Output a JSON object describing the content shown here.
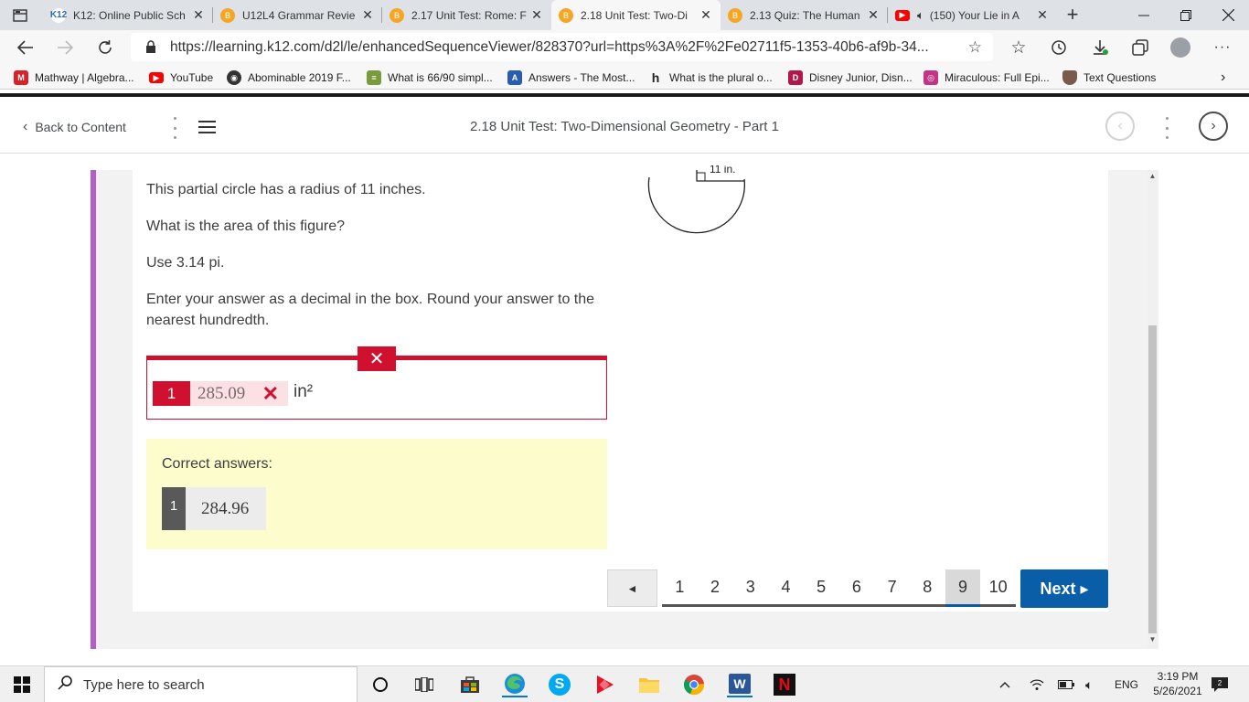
{
  "browser": {
    "tabs": [
      {
        "title": "K12: Online Public Sch",
        "favicon": "k12-icon",
        "active": false
      },
      {
        "title": "U12L4 Grammar Revie",
        "favicon": "brainly-icon",
        "active": false
      },
      {
        "title": "2.17 Unit Test: Rome: F",
        "favicon": "brainly-icon",
        "active": false
      },
      {
        "title": "2.18 Unit Test: Two-Di",
        "favicon": "brainly-icon",
        "active": true
      },
      {
        "title": "2.13 Quiz: The Human",
        "favicon": "brainly-icon",
        "active": false
      },
      {
        "title": "(150) Your Lie in A",
        "favicon": "youtube-icon",
        "active": false
      }
    ],
    "url": "https://learning.k12.com/d2l/le/enhancedSequenceViewer/828370?url=https%3A%2F%2Fe02711f5-1353-40b6-af9b-34...",
    "bookmarks": [
      {
        "label": "Mathway | Algebra...",
        "icon": "mathway-icon",
        "color": "#d8232a"
      },
      {
        "label": "YouTube",
        "icon": "youtube-icon",
        "color": "#ff0000"
      },
      {
        "label": "Abominable 2019 F...",
        "icon": "film-reel-icon",
        "color": "#333333"
      },
      {
        "label": "What is 66/90 simpl...",
        "icon": "calculator-icon",
        "color": "#7a9b3c"
      },
      {
        "label": "Answers - The Most...",
        "icon": "answers-icon",
        "color": "#2a5db0"
      },
      {
        "label": "What is the plural o...",
        "icon": "h-icon",
        "color": "#222222"
      },
      {
        "label": "Disney Junior, Disn...",
        "icon": "disney-icon",
        "color": "#b0184a"
      },
      {
        "label": "Miraculous: Full Epi...",
        "icon": "instagram-icon",
        "color": "#c13584"
      },
      {
        "label": "Text Questions",
        "icon": "shield-icon",
        "color": "#7a5a4a"
      }
    ]
  },
  "app": {
    "back_label": "Back to Content",
    "page_title": "2.18 Unit Test: Two-Dimensional Geometry - Part 1"
  },
  "question": {
    "line1": "This partial circle has a radius of 11 inches.",
    "line2": "What is the area of this figure?",
    "line3": "Use 3.14 pi.",
    "line4": "Enter your answer as a decimal in the box. Round your answer to the nearest hundredth.",
    "figure_label": "11 in.",
    "answer_index": "1",
    "answer_value": "285.09",
    "answer_unit": "in²",
    "answer_status": "incorrect",
    "correct_label": "Correct answers:",
    "correct_index": "1",
    "correct_value": "284.96"
  },
  "pagination": {
    "prev_label": "◄",
    "pages": [
      "1",
      "2",
      "3",
      "4",
      "5",
      "6",
      "7",
      "8",
      "9",
      "10"
    ],
    "current": "9",
    "next_label": "Next ▸"
  },
  "taskbar": {
    "search_placeholder": "Type here to search",
    "language": "ENG",
    "time": "3:19 PM",
    "date": "5/26/2021"
  },
  "colors": {
    "error_red": "#d0102f",
    "correct_bg": "#fcfccd",
    "next_blue": "#0a5ea8",
    "accent_purple": "#b45ec7"
  }
}
